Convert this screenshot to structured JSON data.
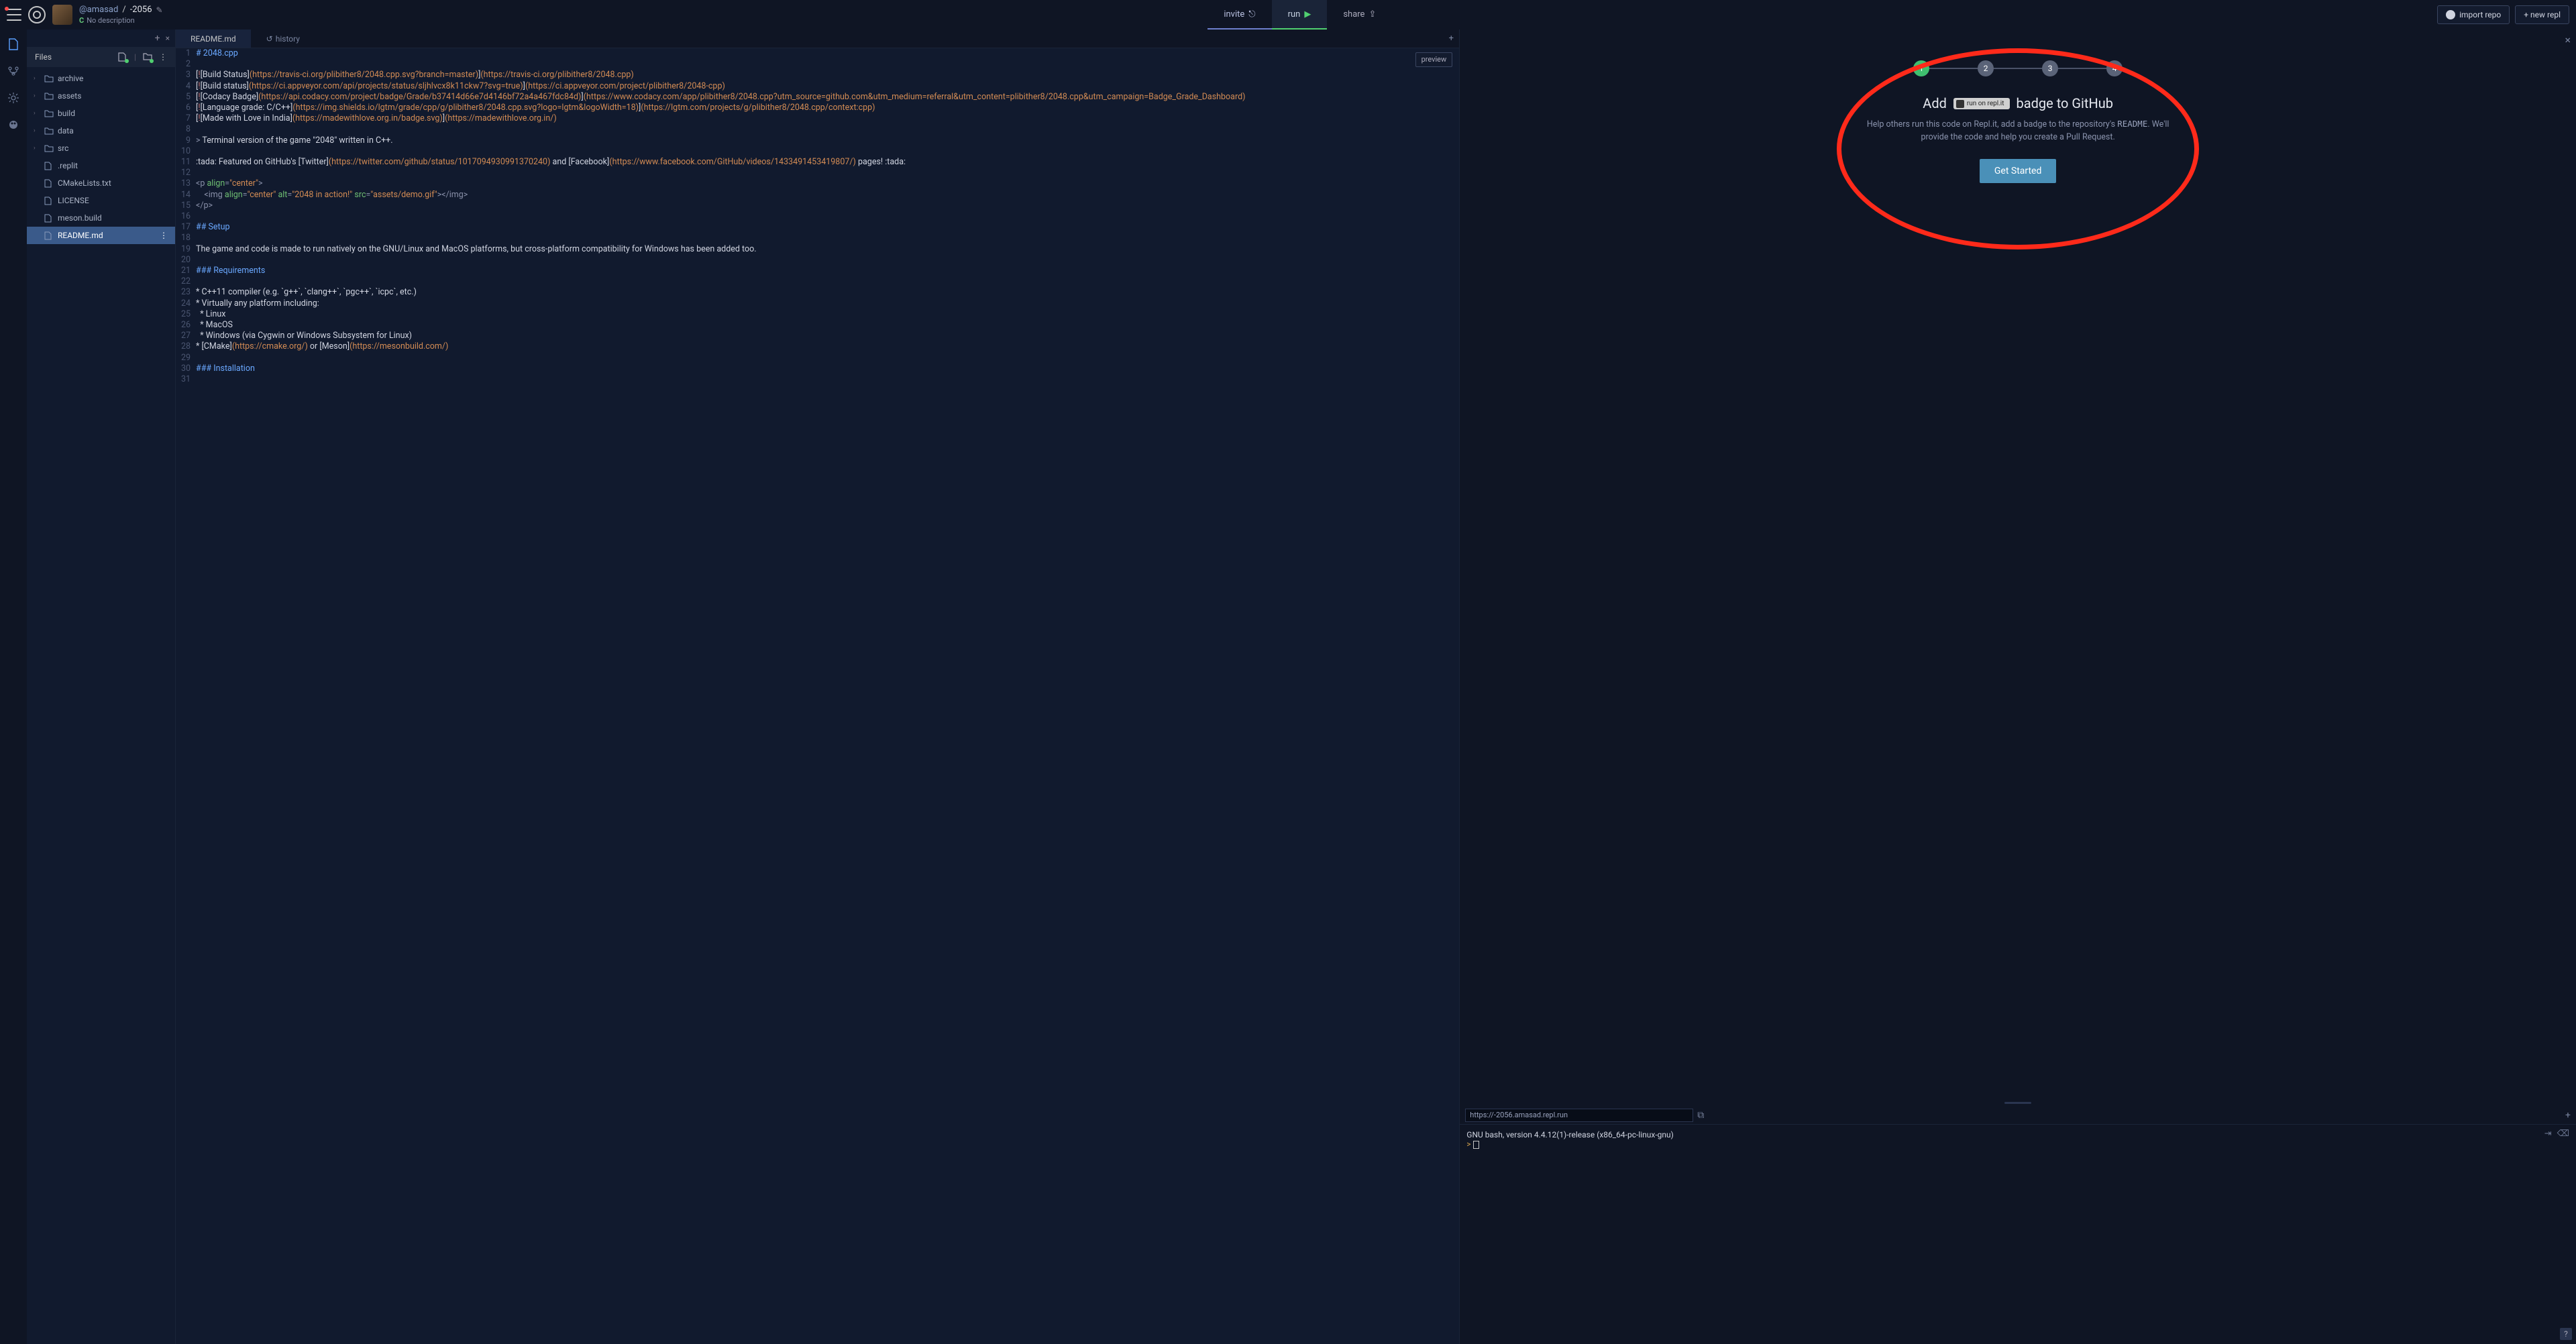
{
  "header": {
    "user": "@amasad",
    "sep": "/",
    "repl": "-2056",
    "desc_icon": "C",
    "desc": "No description",
    "invite": "invite",
    "run": "run",
    "share": "share",
    "import": "import repo",
    "newrepl": "+ new repl"
  },
  "rail": [
    "file-icon",
    "share-icon",
    "gear-icon",
    "package-icon"
  ],
  "files": {
    "title": "Files",
    "items": [
      {
        "name": "archive",
        "kind": "folder"
      },
      {
        "name": "assets",
        "kind": "folder"
      },
      {
        "name": "build",
        "kind": "folder"
      },
      {
        "name": "data",
        "kind": "folder"
      },
      {
        "name": "src",
        "kind": "folder"
      },
      {
        "name": ".replit",
        "kind": "file"
      },
      {
        "name": "CMakeLists.txt",
        "kind": "file"
      },
      {
        "name": "LICENSE",
        "kind": "file"
      },
      {
        "name": "meson.build",
        "kind": "file"
      },
      {
        "name": "README.md",
        "kind": "file",
        "selected": true
      }
    ]
  },
  "editor": {
    "tab": "README.md",
    "history": "history",
    "preview": "preview",
    "lines": [
      {
        "n": 1,
        "seg": [
          {
            "t": "# 2048.cpp",
            "c": "c-blue"
          }
        ]
      },
      {
        "n": 2,
        "seg": []
      },
      {
        "n": 3,
        "seg": [
          {
            "t": "[",
            "c": "c-white"
          },
          {
            "t": "!",
            "c": "c-kw"
          },
          {
            "t": "[Build Status]",
            "c": "c-white"
          },
          {
            "t": "(https://travis-ci.org/plibither8/2048.cpp.svg?branch=master)",
            "c": "c-orange"
          },
          {
            "t": "]",
            "c": "c-white"
          },
          {
            "t": "(https://travis-ci.org/plibither8/2048.cpp)",
            "c": "c-orange"
          }
        ]
      },
      {
        "n": 4,
        "seg": [
          {
            "t": "[",
            "c": "c-white"
          },
          {
            "t": "!",
            "c": "c-kw"
          },
          {
            "t": "[Build status]",
            "c": "c-white"
          },
          {
            "t": "(https://ci.appveyor.com/api/projects/status/sljhlvcx8k11ckw7?svg=true)",
            "c": "c-orange"
          },
          {
            "t": "]",
            "c": "c-white"
          },
          {
            "t": "(https://ci.appveyor.com/project/plibither8/2048-cpp)",
            "c": "c-orange"
          }
        ]
      },
      {
        "n": 5,
        "seg": [
          {
            "t": "[",
            "c": "c-white"
          },
          {
            "t": "!",
            "c": "c-kw"
          },
          {
            "t": "[Codacy Badge]",
            "c": "c-white"
          },
          {
            "t": "(https://api.codacy.com/project/badge/Grade/b37414d66e7d4146bf72a4a467fdc84d)",
            "c": "c-orange"
          },
          {
            "t": "]",
            "c": "c-white"
          },
          {
            "t": "(https://www.codacy.com/app/plibither8/2048.cpp?utm_source=github.com&utm_medium=referral&utm_content=plibither8/2048.cpp&utm_campaign=Badge_Grade_Dashboard)",
            "c": "c-orange"
          }
        ]
      },
      {
        "n": 6,
        "seg": [
          {
            "t": "[",
            "c": "c-white"
          },
          {
            "t": "!",
            "c": "c-kw"
          },
          {
            "t": "[Language grade: C/C++]",
            "c": "c-white"
          },
          {
            "t": "(https://img.shields.io/lgtm/grade/cpp/g/plibither8/2048.cpp.svg?logo=lgtm&logoWidth=18)",
            "c": "c-orange"
          },
          {
            "t": "]",
            "c": "c-white"
          },
          {
            "t": "(https://lgtm.com/projects/g/plibither8/2048.cpp/context:cpp)",
            "c": "c-orange"
          }
        ]
      },
      {
        "n": 7,
        "seg": [
          {
            "t": "[",
            "c": "c-white"
          },
          {
            "t": "!",
            "c": "c-kw"
          },
          {
            "t": "[Made with Love in India]",
            "c": "c-white"
          },
          {
            "t": "(https://madewithlove.org.in/badge.svg)",
            "c": "c-orange"
          },
          {
            "t": "]",
            "c": "c-white"
          },
          {
            "t": "(https://madewithlove.org.in/)",
            "c": "c-orange"
          }
        ]
      },
      {
        "n": 8,
        "seg": []
      },
      {
        "n": 9,
        "seg": [
          {
            "t": "> ",
            "c": "c-grey"
          },
          {
            "t": "Terminal version of the game \"2048\" written in C++.",
            "c": "c-white"
          }
        ]
      },
      {
        "n": 10,
        "seg": []
      },
      {
        "n": 11,
        "seg": [
          {
            "t": ":tada: Featured on GitHub's ",
            "c": "c-white"
          },
          {
            "t": "[Twitter]",
            "c": "c-white"
          },
          {
            "t": "(https://twitter.com/github/status/1017094930991370240)",
            "c": "c-orange"
          },
          {
            "t": " and ",
            "c": "c-white"
          },
          {
            "t": "[Facebook]",
            "c": "c-white"
          },
          {
            "t": "(https://www.facebook.com/GitHub/videos/1433491453419807/)",
            "c": "c-orange"
          },
          {
            "t": " pages! :tada:",
            "c": "c-white"
          }
        ]
      },
      {
        "n": 12,
        "seg": []
      },
      {
        "n": 13,
        "seg": [
          {
            "t": "<p ",
            "c": "c-grey"
          },
          {
            "t": "align",
            "c": "c-green"
          },
          {
            "t": "=",
            "c": "c-grey"
          },
          {
            "t": "\"center\"",
            "c": "c-orange"
          },
          {
            "t": ">",
            "c": "c-grey"
          }
        ]
      },
      {
        "n": 14,
        "seg": [
          {
            "t": "    <img ",
            "c": "c-grey"
          },
          {
            "t": "align",
            "c": "c-green"
          },
          {
            "t": "=",
            "c": "c-grey"
          },
          {
            "t": "\"center\"",
            "c": "c-orange"
          },
          {
            "t": " ",
            "c": "c-grey"
          },
          {
            "t": "alt",
            "c": "c-green"
          },
          {
            "t": "=",
            "c": "c-grey"
          },
          {
            "t": "\"2048 in action!\"",
            "c": "c-orange"
          },
          {
            "t": " ",
            "c": "c-grey"
          },
          {
            "t": "src",
            "c": "c-green"
          },
          {
            "t": "=",
            "c": "c-grey"
          },
          {
            "t": "\"assets/demo.gif\"",
            "c": "c-orange"
          },
          {
            "t": "></img>",
            "c": "c-grey"
          }
        ]
      },
      {
        "n": 15,
        "seg": [
          {
            "t": "</p>",
            "c": "c-grey"
          }
        ]
      },
      {
        "n": 16,
        "seg": []
      },
      {
        "n": 17,
        "seg": [
          {
            "t": "## Setup",
            "c": "c-blue"
          }
        ]
      },
      {
        "n": 18,
        "seg": []
      },
      {
        "n": 19,
        "seg": [
          {
            "t": "The game and code is made to run natively on the GNU/Linux and MacOS platforms, but cross-platform compatibility for Windows has been added too.",
            "c": "c-white"
          }
        ]
      },
      {
        "n": 20,
        "seg": []
      },
      {
        "n": 21,
        "seg": [
          {
            "t": "### Requirements",
            "c": "c-blue"
          }
        ]
      },
      {
        "n": 22,
        "seg": []
      },
      {
        "n": 23,
        "seg": [
          {
            "t": "* C++11 compiler (e.g. `g++`, `clang++`, `pgc++`, `icpc`, etc.)",
            "c": "c-white"
          }
        ]
      },
      {
        "n": 24,
        "seg": [
          {
            "t": "* Virtually any platform including:",
            "c": "c-white"
          }
        ]
      },
      {
        "n": 25,
        "seg": [
          {
            "t": "  * Linux",
            "c": "c-white"
          }
        ]
      },
      {
        "n": 26,
        "seg": [
          {
            "t": "  * MacOS",
            "c": "c-white"
          }
        ]
      },
      {
        "n": 27,
        "seg": [
          {
            "t": "  * Windows (via Cygwin or Windows Subsystem for Linux)",
            "c": "c-white"
          }
        ]
      },
      {
        "n": 28,
        "seg": [
          {
            "t": "* ",
            "c": "c-white"
          },
          {
            "t": "[CMake]",
            "c": "c-white"
          },
          {
            "t": "(https://cmake.org/)",
            "c": "c-orange"
          },
          {
            "t": " or ",
            "c": "c-white"
          },
          {
            "t": "[Meson]",
            "c": "c-white"
          },
          {
            "t": "(https://mesonbuild.com/)",
            "c": "c-orange"
          }
        ]
      },
      {
        "n": 29,
        "seg": []
      },
      {
        "n": 30,
        "seg": [
          {
            "t": "### Installation",
            "c": "c-blue"
          }
        ]
      },
      {
        "n": 31,
        "seg": []
      }
    ]
  },
  "panel": {
    "steps": [
      "1",
      "2",
      "3",
      "4"
    ],
    "title_pre": "Add",
    "badge": "run on repl.it",
    "title_post": "badge to GitHub",
    "sub_a": "Help others run this code on Repl.it, add a badge to the repository's ",
    "sub_code": "README",
    "sub_b": ". We'll provide the code and help you create a Pull Request.",
    "cta": "Get Started"
  },
  "preview_url": "https://-2056.amasad.repl.run",
  "terminal": {
    "line1": "GNU bash, version 4.4.12(1)-release (x86_64-pc-linux-gnu)",
    "prompt": ">"
  },
  "help": "?"
}
